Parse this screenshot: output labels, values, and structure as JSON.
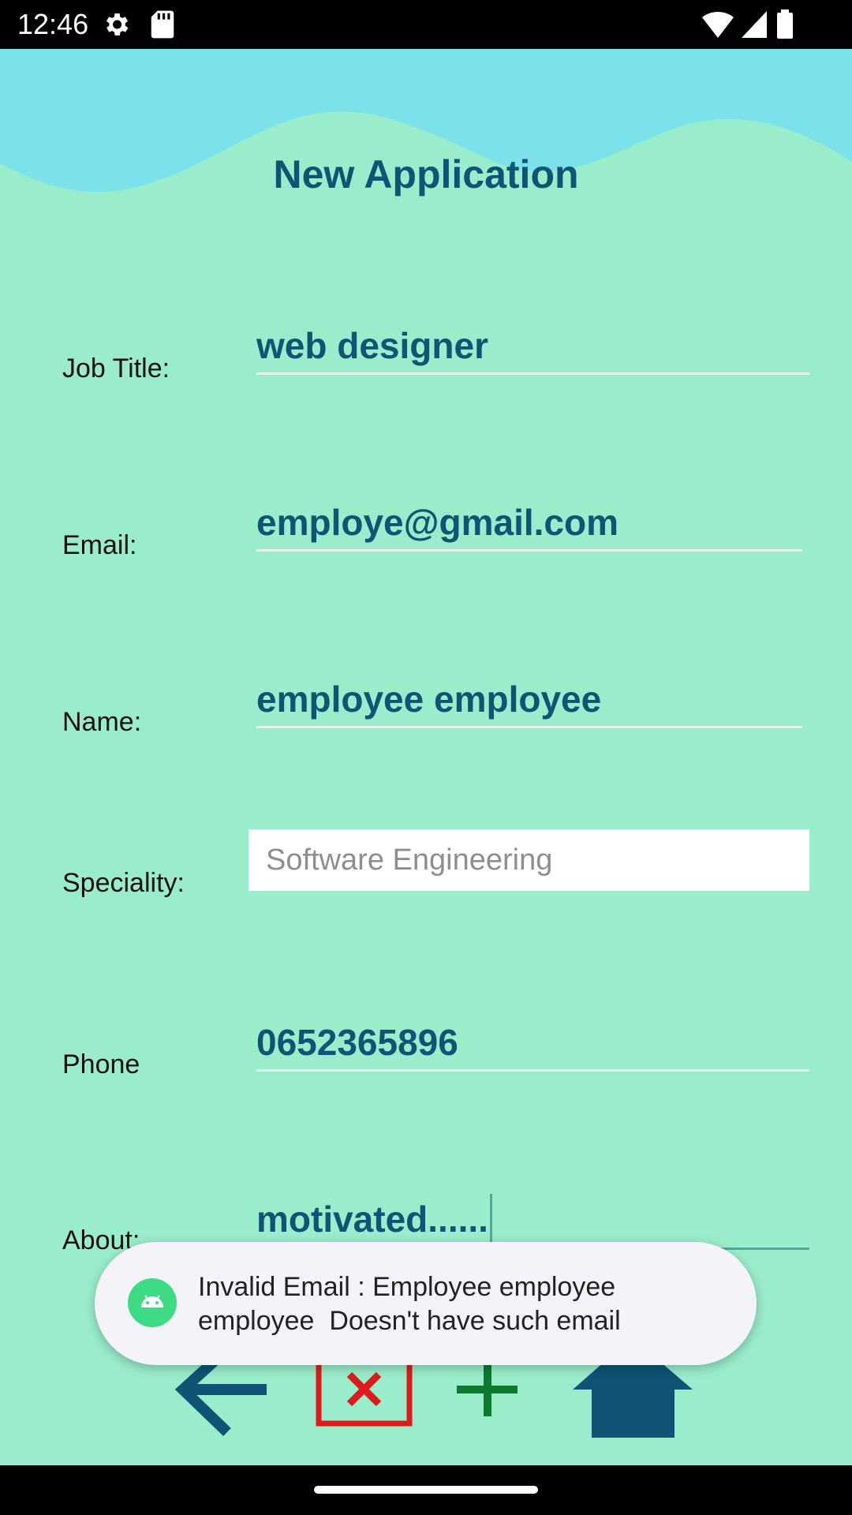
{
  "status_bar": {
    "time": "12:46",
    "icons": [
      "settings-icon",
      "sd-card-icon",
      "wifi-icon",
      "signal-icon",
      "battery-icon"
    ]
  },
  "header": {
    "title": "New Application"
  },
  "form": {
    "job_title": {
      "label": "Job Title:",
      "value": "web designer"
    },
    "email": {
      "label": "Email:",
      "value": "employe@gmail.com"
    },
    "name": {
      "label": "Name:",
      "value": "employee employee"
    },
    "speciality": {
      "label": "Speciality:",
      "selected": "Software Engineering"
    },
    "phone": {
      "label": "Phone",
      "value": "0652365896"
    },
    "about": {
      "label": "About:",
      "value": "motivated......"
    }
  },
  "toast": {
    "icon": "android-icon",
    "line1": "Invalid Email : Employee employee",
    "line2": "employee  Doesn't have such email"
  },
  "actions": {
    "icons": [
      "back-arrow-icon",
      "delete-x-icon",
      "add-plus-icon",
      "home-icon"
    ]
  },
  "colors": {
    "background": "#9AEDCB",
    "wave": "#7BE1EA",
    "accent": "#0F5474",
    "delete": "#E01A1A",
    "add": "#0B7A2E"
  }
}
